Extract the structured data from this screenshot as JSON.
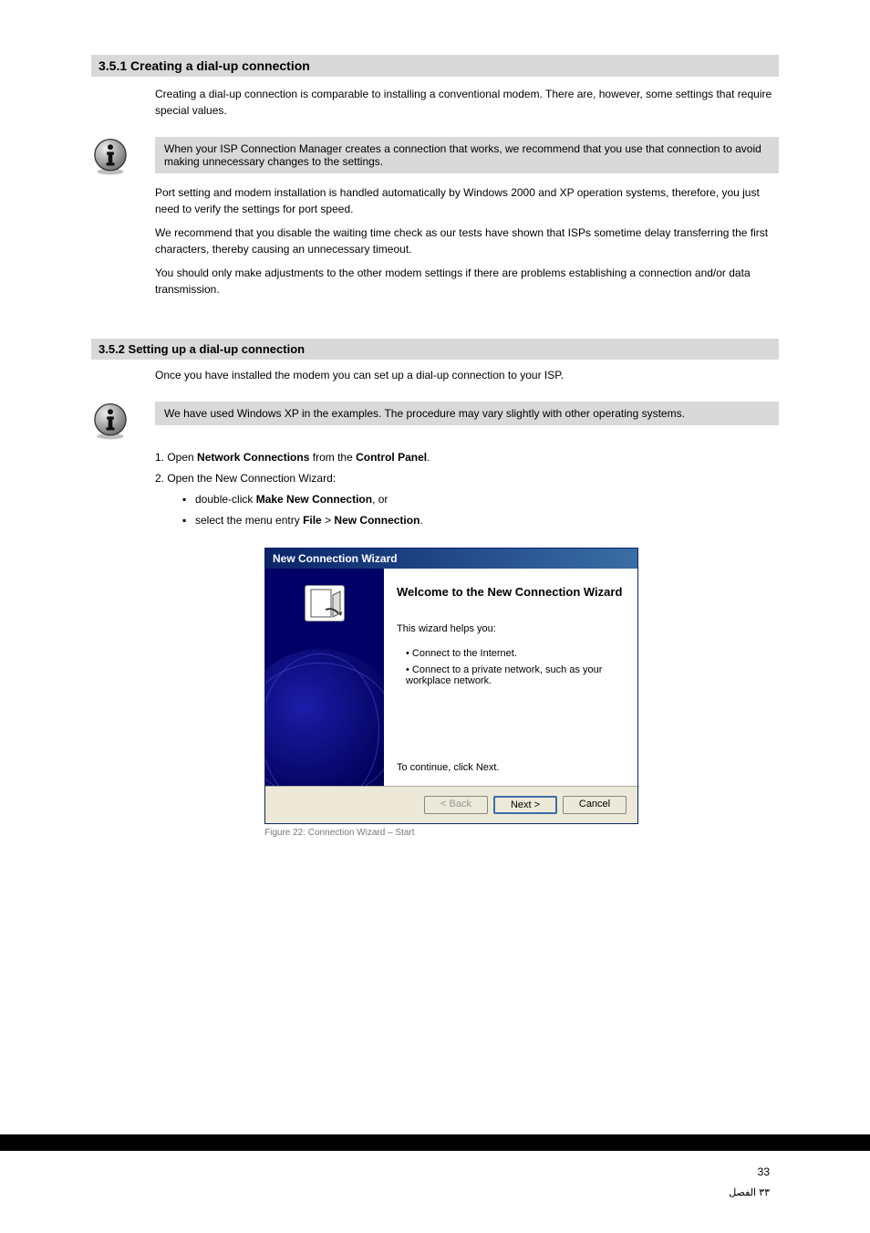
{
  "section1": {
    "title": "3.5.1 Creating a dial-up connection",
    "intro": "Creating a dial-up connection is comparable to installing a conventional modem. There are, however, some settings that require special values.",
    "note": "When your ISP Connection Manager creates a connection that works, we recommend that you use that connection to avoid making unnecessary changes to the settings.",
    "para2": "Port setting and modem installation is handled automatically by Windows 2000 and XP operation systems, therefore, you just need to verify the settings for port speed.",
    "para3": "We recommend that you disable the waiting time check as our tests have shown that ISPs sometime delay transferring the first characters, thereby causing an unnecessary timeout.",
    "para4": "You should only make adjustments to the other modem settings if there are problems establishing a connection and/or data transmission."
  },
  "section2": {
    "title": "3.5.2 Setting up a dial-up connection",
    "intro": "Once you have installed the modem you can set up a dial-up connection to your ISP.",
    "note": "We have used Windows XP in the examples. The procedure may vary slightly with other operating systems.",
    "steps": {
      "s1_pre": "Open ",
      "s1_b1": "Network Connections",
      "s1_mid": " from the ",
      "s1_b2": "Control Panel",
      "s1_end": ".",
      "s2": "Open the New Connection Wizard:",
      "s2a_pre": "double-click ",
      "s2a_b": "Make New Connection",
      "s2a_end": ", or",
      "s2b_pre": "select the menu entry ",
      "s2b_b1": "File",
      "s2b_mid": " > ",
      "s2b_b2": "New Connection",
      "s2b_end": "."
    }
  },
  "wizard": {
    "title": "New Connection Wizard",
    "heading": "Welcome to the New Connection Wizard",
    "helps": "This wizard helps you:",
    "b1": "Connect to the Internet.",
    "b2": "Connect to a private network, such as your workplace network.",
    "continue": "To continue, click Next.",
    "back": "< Back",
    "next": "Next >",
    "cancel": "Cancel"
  },
  "caption": "Figure 22: Connection Wizard – Start",
  "pageno": "33",
  "arabic": "٣٣ الفصل"
}
